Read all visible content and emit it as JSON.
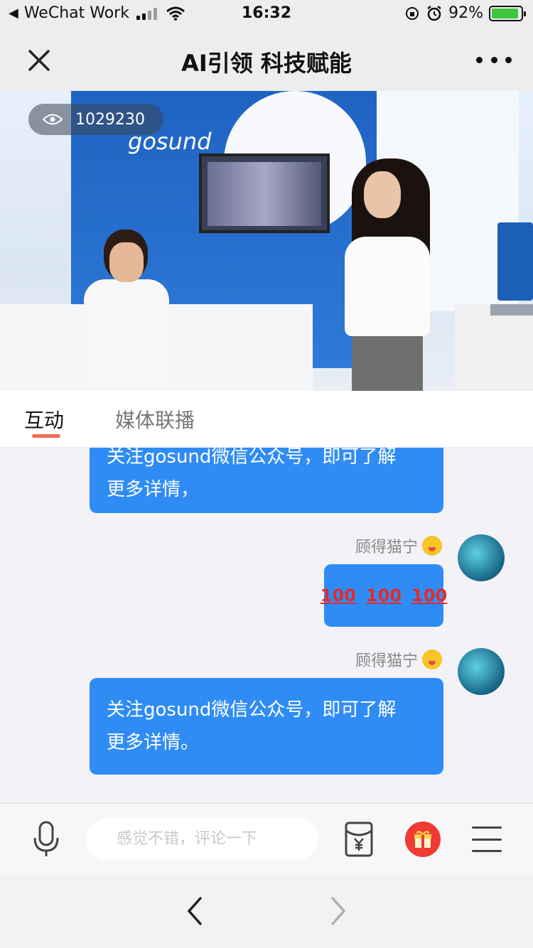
{
  "status_bar": {
    "back_app_label": "WeChat Work",
    "time": "16:32",
    "battery_percent": "92%",
    "battery_level": 0.92
  },
  "nav": {
    "title": "AI引领 科技赋能",
    "close_icon": "close-icon",
    "more_icon": "more-icon"
  },
  "video": {
    "view_count": "1029230",
    "brand_text": "gosund"
  },
  "tabs": [
    {
      "label": "互动",
      "active": true
    },
    {
      "label": "媒体联播",
      "active": false
    }
  ],
  "chat": {
    "messages": [
      {
        "sender": "",
        "line1": "关注gosund微信公众号，即可了解",
        "line2": "更多详情，"
      },
      {
        "sender": "顾得猫宁",
        "hundreds": [
          "100",
          "100",
          "100"
        ]
      },
      {
        "sender": "顾得猫宁",
        "line1": "关注gosund微信公众号，即可了解",
        "line2": "更多详情。"
      }
    ]
  },
  "input_bar": {
    "comment_placeholder": "感觉不错，评论一下",
    "icons": [
      "microphone-icon",
      "red-packet-icon",
      "gift-icon",
      "menu-icon"
    ]
  },
  "bottom_nav": {
    "icons": [
      "back-arrow-icon",
      "forward-arrow-icon"
    ]
  },
  "colors": {
    "bubble": "#2f8cf5",
    "tab_accent": "#f36b55",
    "gift": "#ef3b34"
  }
}
